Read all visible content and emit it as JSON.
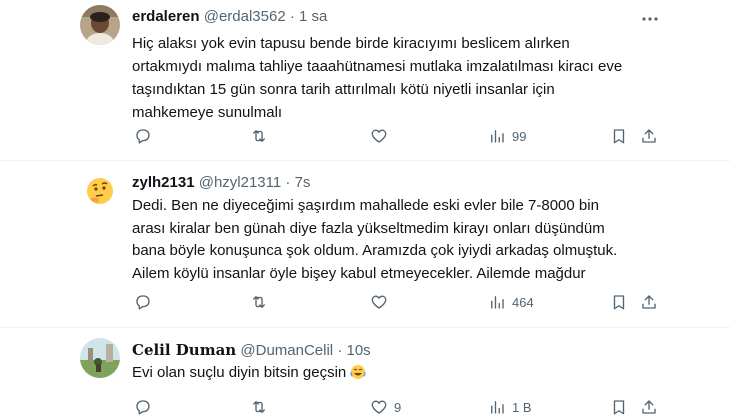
{
  "tweets": [
    {
      "author_name": "erdaleren",
      "handle": "@erdal3562",
      "separator": "·",
      "time": "1 sa",
      "avatar_icon": "person-photo-avatar",
      "text": "Hiç alaksı yok evin tapusu bende birde kiracıyımı beslicem alırken ortakmıydı malıma tahliye taaahütnamesi mutlaka imzalatılması kiracı eve taşındıktan 15 gün sonra tarih attırılmalı kötü niyetli insanlar için mahkemeye sunulmalı",
      "replies": "",
      "retweets": "",
      "likes": "",
      "views": "99"
    },
    {
      "author_name": "zylh2131",
      "handle": "@hzyl21311",
      "separator": "·",
      "time": "7s",
      "avatar_icon": "thinking-face-emoji-avatar",
      "text": "Dedi. Ben ne diyeceğimi şaşırdım mahallede eski evler bile 7-8000 bin arası kiralar ben günah diye fazla yükseltmedim kirayı onları düşündüm bana böyle konuşunca şok oldum. Aramızda çok iyiydi arkadaş olmuştuk. Ailem köylü insanlar öyle bişey kabul etmeyecekler. Ailemde mağdur",
      "replies": "",
      "retweets": "",
      "likes": "",
      "views": "464"
    },
    {
      "author_name": "Celil Duman",
      "handle": "@DumanCelil",
      "separator": "·",
      "time": "10s",
      "avatar_icon": "landscape-photo-avatar",
      "text": "Evi olan suçlu diyin bitsin geçsin",
      "emoji": "😂",
      "replies": "",
      "retweets": "",
      "likes": "9",
      "views": "1 B"
    }
  ],
  "icons": {
    "reply": "reply-icon",
    "retweet": "retweet-icon",
    "like": "heart-icon",
    "views": "views-bar-chart-icon",
    "bookmark": "bookmark-icon",
    "share": "share-icon",
    "more": "more-dots-icon"
  },
  "colors": {
    "text_primary": "#0f1419",
    "text_secondary": "#536471",
    "divider": "#eff3f4"
  }
}
